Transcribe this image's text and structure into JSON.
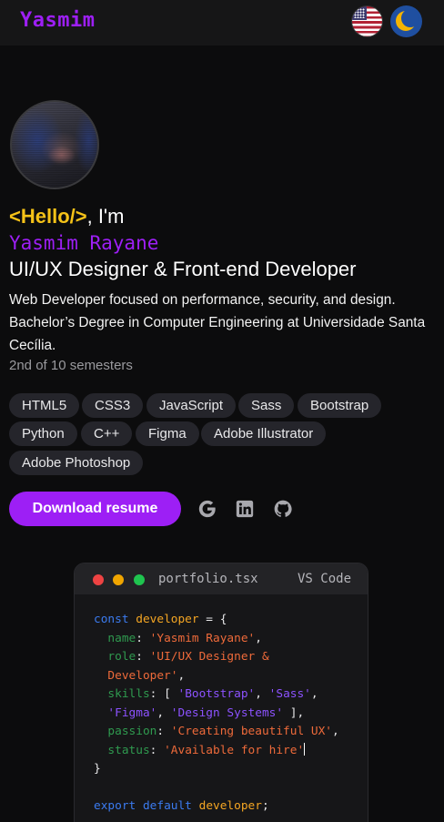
{
  "header": {
    "brand": "Yasmim",
    "language_icon": "us-flag-icon",
    "theme_icon": "moon-icon"
  },
  "hero": {
    "hello_tag": "<Hello/>",
    "hello_suffix": ", I'm",
    "name": "Yasmim Rayane",
    "role": "UI/UX Designer & Front-end Developer",
    "bio": "Web Developer focused on performance, security, and design. Bachelor’s Degree in Computer Engineering at Universidade Santa Cecília.",
    "semester": "2nd of 10 semesters"
  },
  "skills": [
    "HTML5",
    "CSS3",
    "JavaScript",
    "Sass",
    "Bootstrap",
    "Python",
    "C++",
    "Figma",
    "Adobe Illustrator",
    "Adobe Photoshop"
  ],
  "actions": {
    "download_label": "Download resume",
    "social_icons": [
      "google-icon",
      "linkedin-icon",
      "github-icon"
    ]
  },
  "editor": {
    "filename": "portfolio.tsx",
    "app": "VS Code",
    "code": {
      "kw_const": "const",
      "var_name": "developer",
      "eq_brace": " = {",
      "k_name": "name",
      "v_name": "'Yasmim Rayane'",
      "k_role": "role",
      "v_role_1": "'UI/UX Designer &",
      "v_role_2": "Developer'",
      "k_skills": "skills",
      "sk_1": "'Bootstrap'",
      "sk_2": "'Sass'",
      "sk_3": "'Figma'",
      "sk_4": "'Design Systems'",
      "k_passion": "passion",
      "v_passion": "'Creating beautiful UX'",
      "k_status": "status",
      "v_status": "'Available for hire'",
      "close": "}",
      "kw_export": "export",
      "kw_default": "default",
      "export_var": "developer"
    }
  },
  "colors": {
    "accent": "#9d1ff5",
    "hello_tag": "#f5c218",
    "background": "#0c0c0d",
    "chip_bg": "#25252b"
  }
}
